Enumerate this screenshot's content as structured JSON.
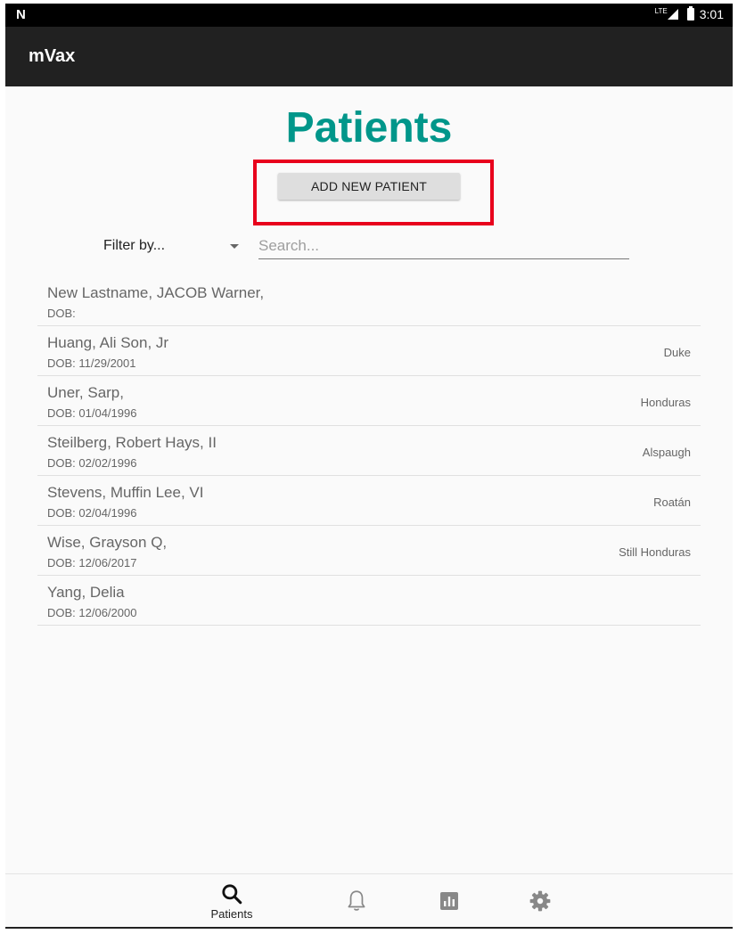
{
  "status_bar": {
    "notification_icon": "N",
    "network": "LTE",
    "time": "3:01"
  },
  "app_bar": {
    "title": "mVax"
  },
  "page": {
    "title": "Patients"
  },
  "actions": {
    "add_patient_label": "ADD NEW PATIENT"
  },
  "filter": {
    "selected": "Filter by..."
  },
  "search": {
    "placeholder": "Search..."
  },
  "patients": [
    {
      "name": "New Lastname, JACOB Warner,",
      "dob": "DOB:",
      "location": ""
    },
    {
      "name": "Huang, Ali Son, Jr",
      "dob": "DOB: 11/29/2001",
      "location": "Duke"
    },
    {
      "name": "Uner, Sarp,",
      "dob": "DOB: 01/04/1996",
      "location": "Honduras"
    },
    {
      "name": "Steilberg, Robert Hays, II",
      "dob": "DOB: 02/02/1996",
      "location": "Alspaugh"
    },
    {
      "name": "Stevens, Muffin Lee, VI",
      "dob": "DOB: 02/04/1996",
      "location": "Roatán"
    },
    {
      "name": "Wise, Grayson Q,",
      "dob": "DOB: 12/06/2017",
      "location": "Still Honduras"
    },
    {
      "name": "Yang, Delia",
      "dob": "DOB: 12/06/2000",
      "location": ""
    }
  ],
  "bottom_nav": {
    "items": [
      {
        "icon": "search-icon",
        "label": "Patients"
      },
      {
        "icon": "bell-icon",
        "label": ""
      },
      {
        "icon": "bar-chart-icon",
        "label": ""
      },
      {
        "icon": "gear-icon",
        "label": ""
      }
    ]
  },
  "colors": {
    "accent": "#00968a",
    "highlight": "#e8001c",
    "app_bar": "#212121"
  }
}
